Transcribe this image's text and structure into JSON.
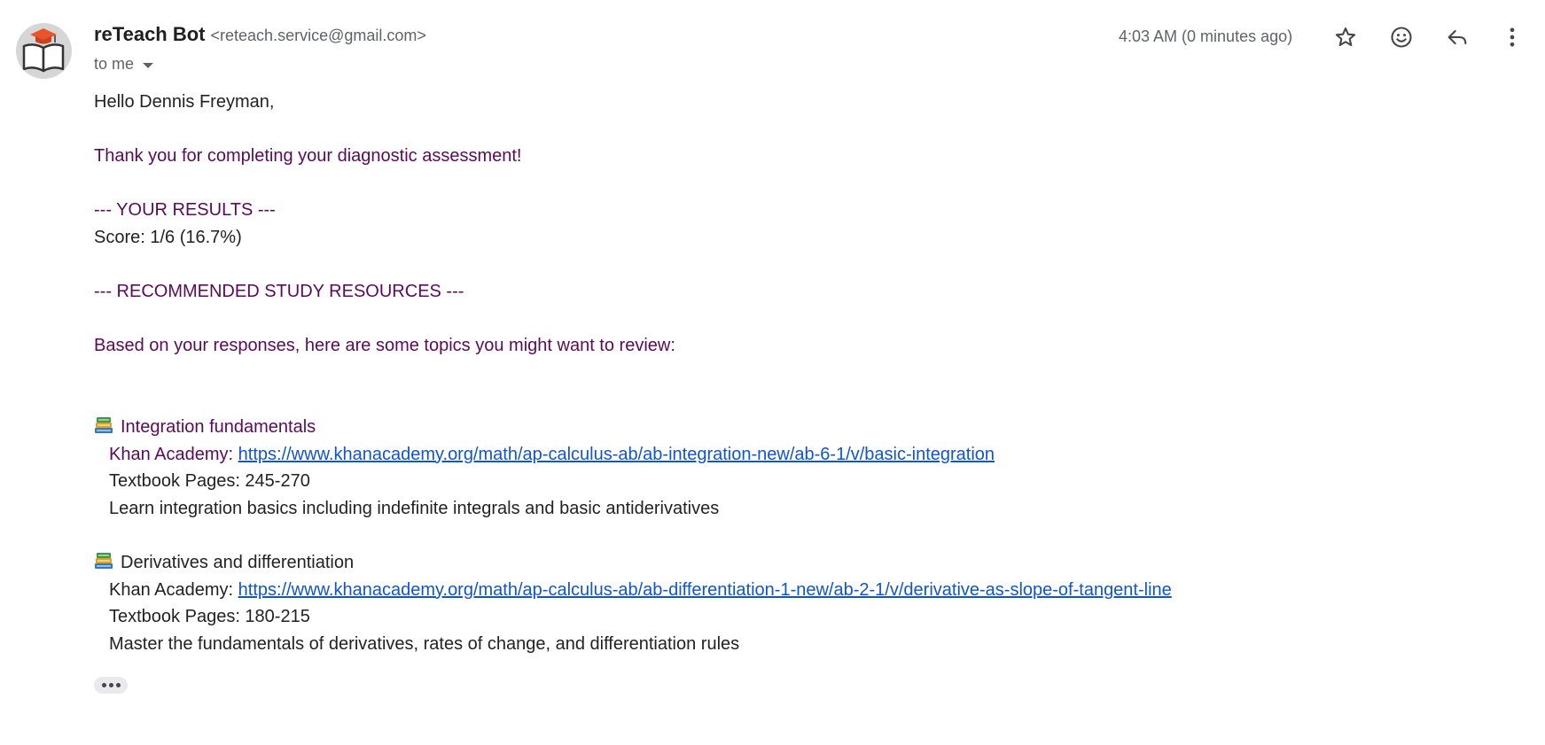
{
  "sender": {
    "name": "reTeach Bot",
    "email": "<reteach.service@gmail.com>",
    "recipient_label": "to me"
  },
  "header": {
    "timestamp": "4:03 AM (0 minutes ago)",
    "icons": [
      "star-icon",
      "emoji-icon",
      "reply-icon",
      "more-vert-icon"
    ]
  },
  "message": {
    "greeting": "Hello Dennis Freyman,",
    "thanks": "Thank you for completing your diagnostic assessment!",
    "results_heading": "--- YOUR RESULTS ---",
    "score": "Score: 1/6 (16.7%)",
    "resources_heading": "--- RECOMMENDED STUDY RESOURCES ---",
    "intro": "Based on your responses, here are some topics you might want to review:",
    "topics": [
      {
        "title": "Integration fundamentals",
        "khan_label": "Khan Academy: ",
        "khan_url": "https://www.khanacademy.org/math/ap-calculus-ab/ab-integration-new/ab-6-1/v/basic-integration",
        "pages": "Textbook Pages: 245-270",
        "description": "Learn integration basics including indefinite integrals and basic antiderivatives"
      },
      {
        "title": "Derivatives and differentiation",
        "khan_label": "Khan Academy: ",
        "khan_url": "https://www.khanacademy.org/math/ap-calculus-ab/ab-differentiation-1-new/ab-2-1/v/derivative-as-slope-of-tangent-line",
        "pages": "Textbook Pages: 180-215",
        "description": "Master the fundamentals of derivatives, rates of change, and differentiation rules"
      }
    ]
  },
  "colors": {
    "accent_text": "#5b0a5b",
    "link": "#1155cc",
    "muted": "#5f6368"
  }
}
